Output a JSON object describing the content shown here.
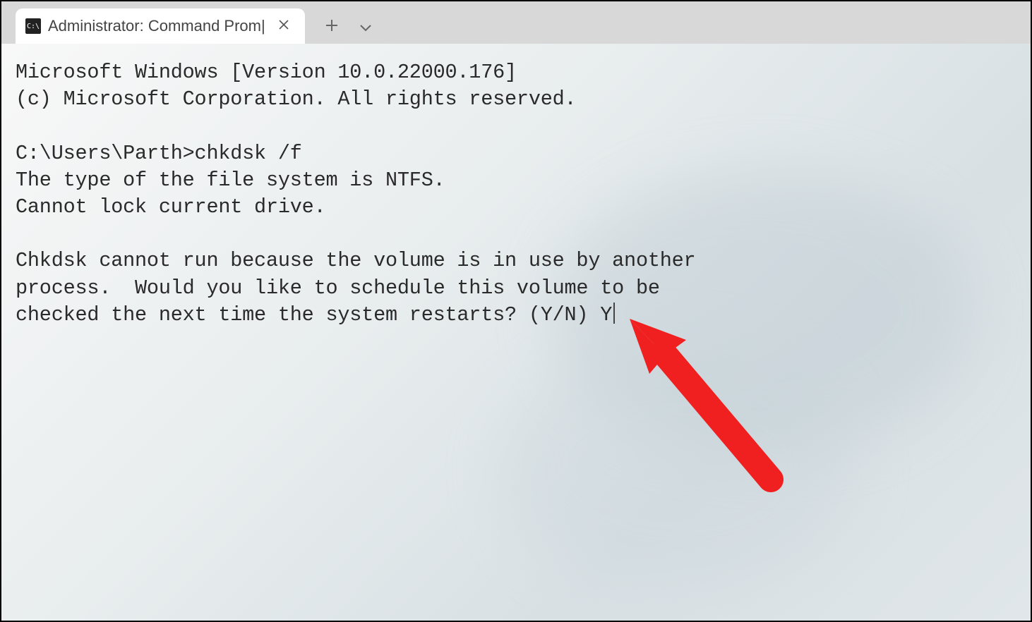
{
  "titlebar": {
    "tab": {
      "icon_text": "C:\\",
      "title": "Administrator: Command Prom|"
    }
  },
  "terminal": {
    "line1": "Microsoft Windows [Version 10.0.22000.176]",
    "line2": "(c) Microsoft Corporation. All rights reserved.",
    "blank1": "",
    "prompt_line": "C:\\Users\\Parth>chkdsk /f",
    "out1": "The type of the file system is NTFS.",
    "out2": "Cannot lock current drive.",
    "blank2": "",
    "out3": "Chkdsk cannot run because the volume is in use by another",
    "out4": "process.  Would you like to schedule this volume to be",
    "out5": "checked the next time the system restarts? (Y/N) Y"
  },
  "annotation": {
    "arrow_color": "#f02020"
  }
}
